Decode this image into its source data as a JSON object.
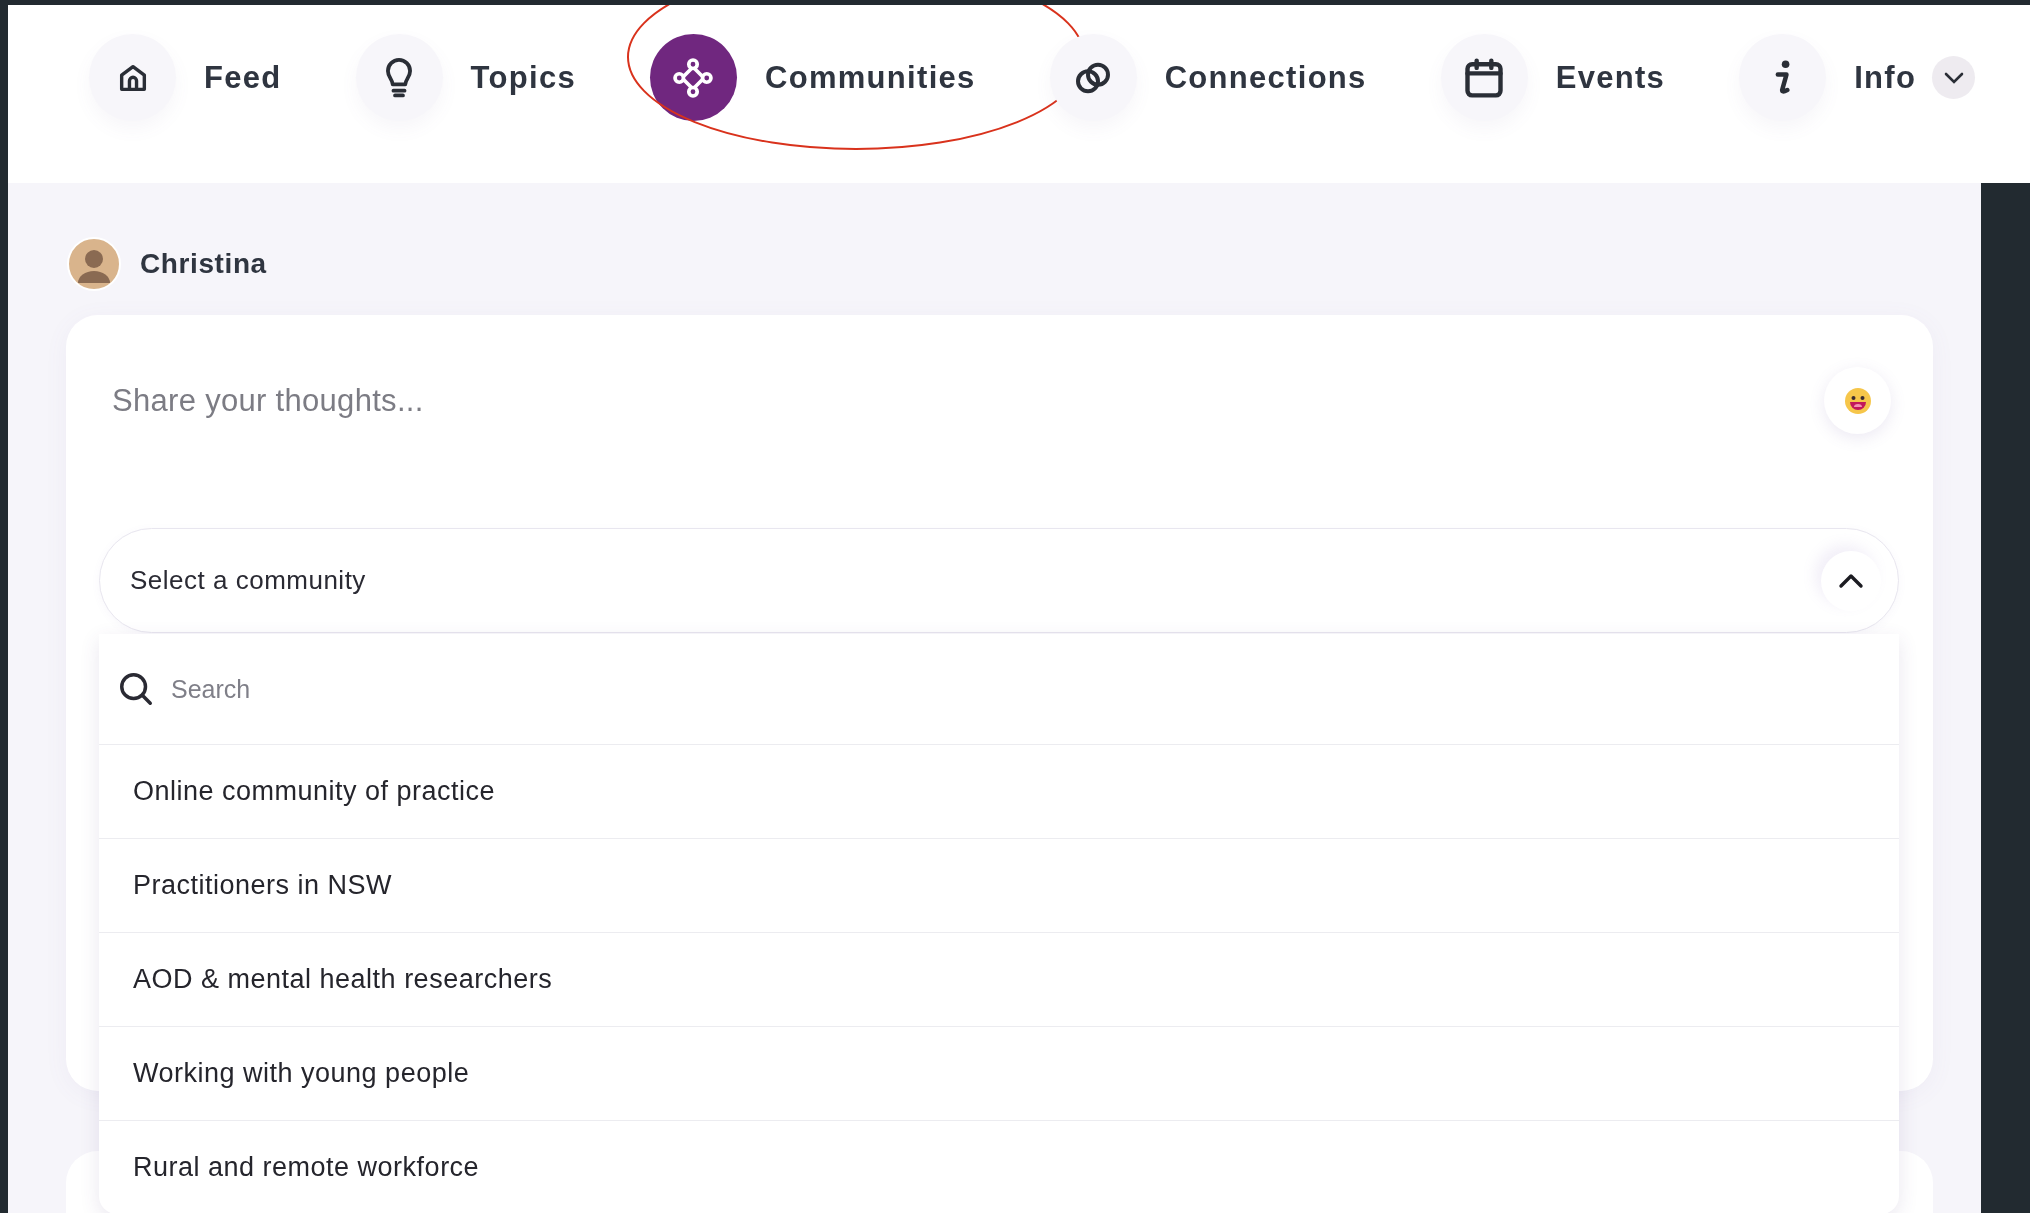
{
  "nav": {
    "items": [
      {
        "kind": "home",
        "label": "Feed",
        "selected": false
      },
      {
        "kind": "bulb",
        "label": "Topics",
        "selected": false
      },
      {
        "kind": "network",
        "label": "Communities",
        "selected": true,
        "circled": true
      },
      {
        "kind": "rings",
        "label": "Connections",
        "selected": false
      },
      {
        "kind": "calendar",
        "label": "Events",
        "selected": false
      },
      {
        "kind": "info",
        "label": "Info",
        "selected": false,
        "has_menu": true
      }
    ]
  },
  "user": {
    "name": "Christina"
  },
  "composer": {
    "placeholder": "Share your thoughts..."
  },
  "community_select": {
    "placeholder": "Select a community",
    "expanded": true,
    "search": {
      "placeholder": "Search"
    },
    "options": [
      "Online community of practice",
      "Practitioners in NSW",
      "AOD & mental health researchers",
      "Working with young people",
      "Rural and remote workforce"
    ]
  }
}
